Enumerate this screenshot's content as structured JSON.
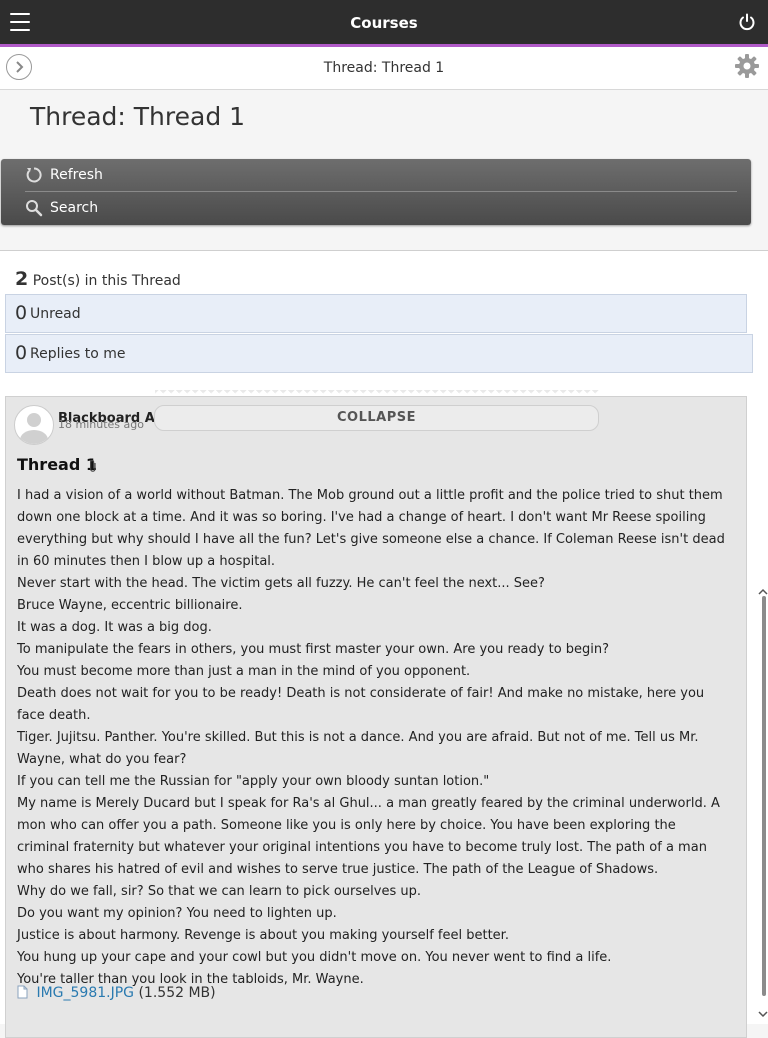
{
  "app": {
    "title": "Courses"
  },
  "subbar": {
    "crumb": "Thread: Thread 1"
  },
  "page": {
    "title": "Thread: Thread 1"
  },
  "actions": {
    "refresh": "Refresh",
    "search": "Search"
  },
  "summary": {
    "posts_count": "2",
    "posts_label": "Post(s) in this Thread",
    "unread_count": "0",
    "unread_label": "Unread",
    "replies_count": "0",
    "replies_label": "Replies to me"
  },
  "post": {
    "author": "Blackboard Administrator",
    "time_ago": "18 minutes ago",
    "collapse_label": "COLLAPSE",
    "title": "Thread 1",
    "lines": [
      "I had a vision of a world without Batman. The Mob ground out a little profit and the police tried to shut them down one block at a time. And it was so boring. I've had a change of heart. I don't want Mr Reese spoiling everything but why should I have all the fun? Let's give someone else a chance. If Coleman Reese isn't dead in 60 minutes then I blow up a hospital.",
      "Never start with the head. The victim gets all fuzzy. He can't feel the next... See?",
      "Bruce Wayne, eccentric billionaire.",
      "It was a dog. It was a big dog.",
      "To manipulate the fears in others, you must first master your own. Are you ready to begin?",
      "You must become more than just a man in the mind of you opponent.",
      "Death does not wait for you to be ready! Death is not considerate of fair! And make no mistake, here you face death.",
      "Tiger. Jujitsu. Panther. You're skilled. But this is not a dance. And you are afraid. But not of me. Tell us Mr. Wayne, what do you fear?",
      "If you can tell me the Russian for \"apply your own bloody suntan lotion.\"",
      "My name is Merely Ducard but I speak for Ra's al Ghul... a man greatly feared by the criminal underworld. A mon who can offer you a path. Someone like you is only here by choice. You have been exploring the criminal fraternity but whatever your original intentions you have to become truly lost. The path of a man who shares his hatred of evil and wishes to serve true justice. The path of the League of Shadows.",
      "Why do we fall, sir? So that we can learn to pick ourselves up.",
      "Do you want my opinion? You need to lighten up.",
      "Justice is about harmony. Revenge is about you making yourself feel better.",
      "You hung up your cape and your cowl but you didn't move on. You never went to find a life.",
      "You're taller than you look in the tabloids, Mr. Wayne."
    ],
    "attachment_name": "IMG_5981.JPG",
    "attachment_size": "(1.552 MB)"
  }
}
